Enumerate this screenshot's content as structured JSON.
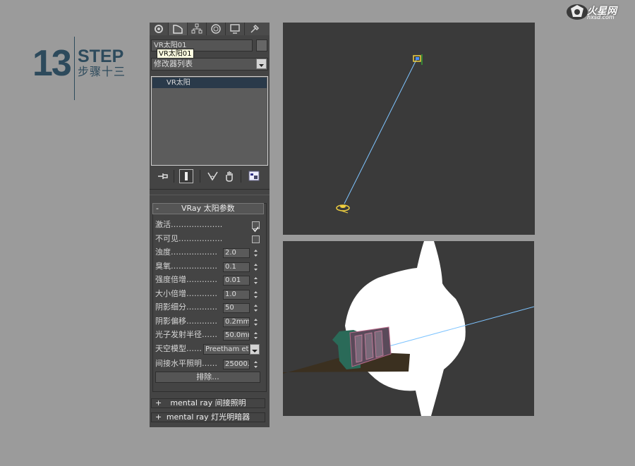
{
  "step": {
    "number": "13",
    "word": "STEP",
    "subtitle": "步骤十三"
  },
  "logo": {
    "name": "火星网",
    "url": "hxsd.com"
  },
  "panel": {
    "tabs": [
      "create-icon",
      "modify-icon",
      "hierarchy-icon",
      "motion-icon",
      "display-icon",
      "utilities-icon"
    ],
    "object_name": "VR太阳01",
    "tooltip": "VR太阳01",
    "modifier_list": "修改器列表",
    "stack_item": "VR太阳",
    "stack_tools": [
      "pin-stack-icon",
      "show-end-result-icon",
      "make-unique-icon",
      "remove-modifier-icon",
      "configure-sets-icon"
    ]
  },
  "vray_sun": {
    "title": "VRay 太阳参数",
    "collapse_symbol": "-",
    "params": [
      {
        "label": "激活…………………………",
        "type": "checkbox",
        "checked": true
      },
      {
        "label": "不可见…………………………",
        "type": "checkbox",
        "checked": false
      },
      {
        "label": "浊度………………",
        "type": "spinner",
        "value": "2.0"
      },
      {
        "label": "臭氧………………",
        "type": "spinner",
        "value": "0.1"
      },
      {
        "label": "强度倍增…………",
        "type": "spinner",
        "value": "0.01"
      },
      {
        "label": "大小倍增…………",
        "type": "spinner",
        "value": "1.0"
      },
      {
        "label": "阴影细分…………",
        "type": "spinner",
        "value": "50"
      },
      {
        "label": "阴影偏移…………",
        "type": "spinner",
        "value": "0.2mm"
      },
      {
        "label": "光子发射半径……",
        "type": "spinner",
        "value": "50.0mm"
      }
    ],
    "sky_model_label": "天空模型……",
    "sky_model_value": "Preetham et",
    "indirect_label": "间接水平照明……",
    "indirect_value": "25000.0",
    "exclude_label": "排除..."
  },
  "rollouts": [
    {
      "symbol": "+",
      "label": "mental ray 间接照明"
    },
    {
      "symbol": "+",
      "label": "mental ray 灯光明暗器"
    }
  ],
  "colors": {
    "step_text": "#2d4a5c",
    "panel_bg": "#444444",
    "viewport_bg": "#3a3a3a",
    "light_line": "#7ec4ff",
    "sun_icon": "#f0d040"
  }
}
